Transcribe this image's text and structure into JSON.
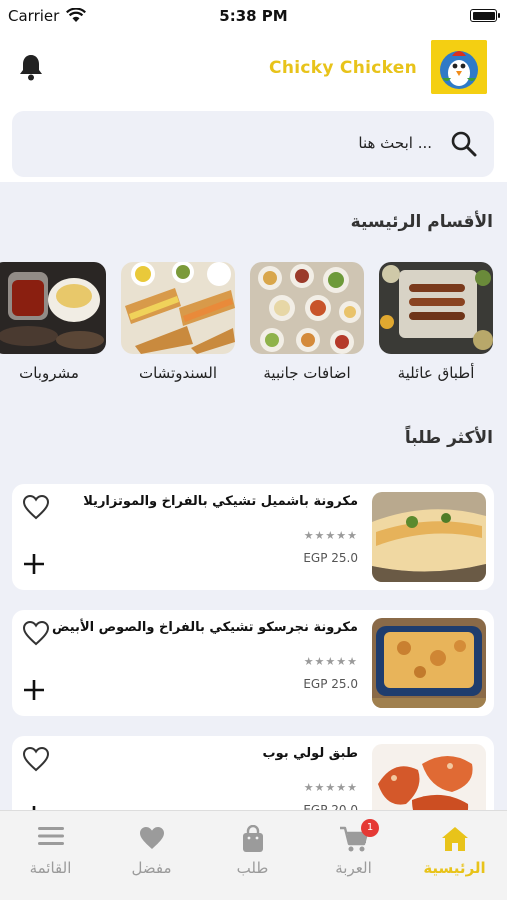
{
  "status_bar": {
    "carrier": "Carrier",
    "time": "5:38 PM"
  },
  "header": {
    "brand": "Chicky Chicken"
  },
  "search": {
    "placeholder": "ابحث هنا ..."
  },
  "categories_section": {
    "title": "الأقسام الرئيسية",
    "items": [
      {
        "label": "أطباق عائلية"
      },
      {
        "label": "اضافات جانبية"
      },
      {
        "label": "السندوتشات"
      },
      {
        "label": "مشروبات"
      }
    ]
  },
  "popular_section": {
    "title": "الأكثر طلباً",
    "products": [
      {
        "name": "مكرونة باشميل تشيكي بالفراخ والموتزاريلا",
        "stars": "★★★★★",
        "price": "EGP 25.0"
      },
      {
        "name": "مكرونة نجرسكو تشيكي بالفراخ والصوص الأبيض",
        "stars": "★★★★★",
        "price": "EGP 25.0"
      },
      {
        "name": "طبق لولي بوب",
        "stars": "★★★★★",
        "price": "EGP 20.0"
      }
    ]
  },
  "tab_bar": {
    "tabs": [
      {
        "label": "القائمة"
      },
      {
        "label": "مفضل"
      },
      {
        "label": "طلب"
      },
      {
        "label": "العربة",
        "badge": "1"
      },
      {
        "label": "الرئيسية"
      }
    ]
  },
  "colors": {
    "accent": "#e8c31a",
    "background": "#eef0f7",
    "badge": "#e53935"
  }
}
